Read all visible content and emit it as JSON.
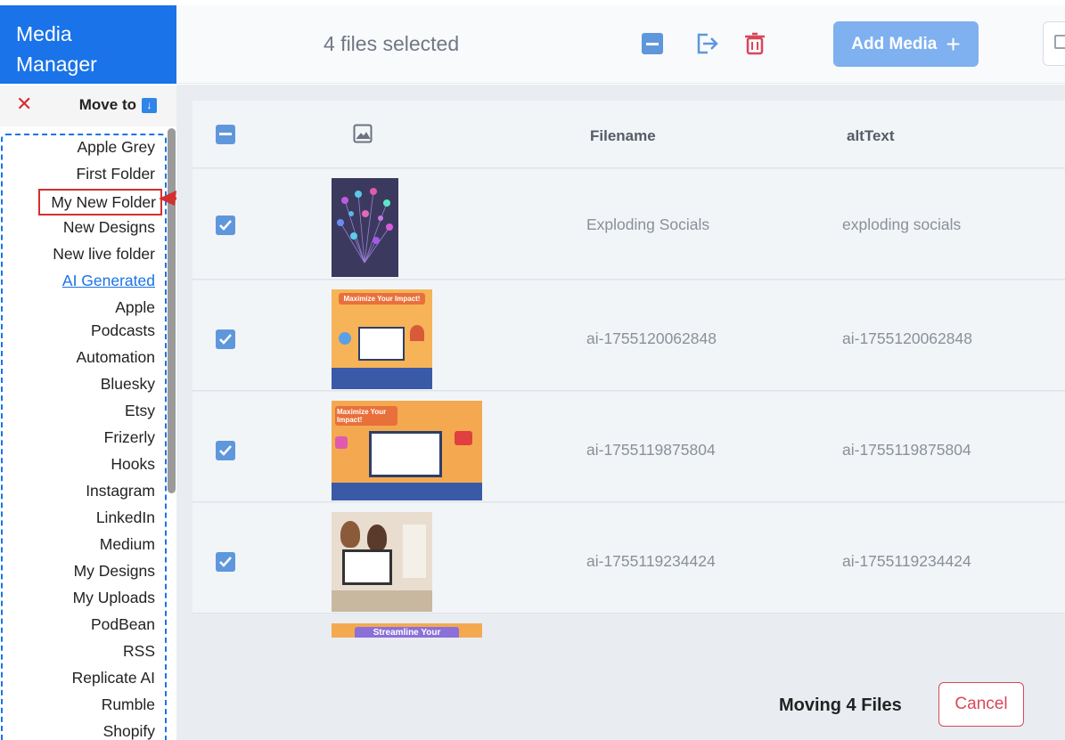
{
  "sidebar": {
    "title_line1": "Media",
    "title_line2": "Manager",
    "close_glyph": "✕",
    "move_to_label": "Move to",
    "move_to_icon": "download-arrow-icon",
    "folders": [
      {
        "label": "Apple Grey"
      },
      {
        "label": "First Folder"
      },
      {
        "label": "My New Folder"
      },
      {
        "label": "New Designs"
      },
      {
        "label": "New live folder"
      },
      {
        "label": "AI Generated"
      },
      {
        "label": "Apple Podcasts"
      },
      {
        "label": "Automation"
      },
      {
        "label": "Bluesky"
      },
      {
        "label": "Etsy"
      },
      {
        "label": "Frizerly"
      },
      {
        "label": "Hooks"
      },
      {
        "label": "Instagram"
      },
      {
        "label": "LinkedIn"
      },
      {
        "label": "Medium"
      },
      {
        "label": "My Designs"
      },
      {
        "label": "My Uploads"
      },
      {
        "label": "PodBean"
      },
      {
        "label": "RSS"
      },
      {
        "label": "Replicate AI"
      },
      {
        "label": "Rumble"
      },
      {
        "label": "Shopify"
      }
    ]
  },
  "toolbar": {
    "selection_text": "4 files selected",
    "add_media_label": "Add Media",
    "icons": [
      "deselect-minus-icon",
      "move-out-icon",
      "trash-icon"
    ]
  },
  "table": {
    "columns": {
      "image": "image-icon",
      "filename": "Filename",
      "alt": "altText"
    },
    "rows": [
      {
        "filename": "Exploding Socials",
        "alt": "exploding socials",
        "checked": true,
        "thumb_text": ""
      },
      {
        "filename": "ai-1755120062848",
        "alt": "ai-1755120062848",
        "checked": true,
        "thumb_text": "Maximize Your Impact!"
      },
      {
        "filename": "ai-1755119875804",
        "alt": "ai-1755119875804",
        "checked": true,
        "thumb_text": "Maximize Your Impact!"
      },
      {
        "filename": "ai-1755119234424",
        "alt": "ai-1755119234424",
        "checked": true,
        "thumb_text": ""
      }
    ],
    "partial_row_thumb_text": "Streamline Your"
  },
  "footer": {
    "moving_text": "Moving 4 Files",
    "cancel_label": "Cancel"
  },
  "colors": {
    "brand": "#1a73e8",
    "danger": "#d32f2f",
    "add_button": "#7fb0ef"
  }
}
